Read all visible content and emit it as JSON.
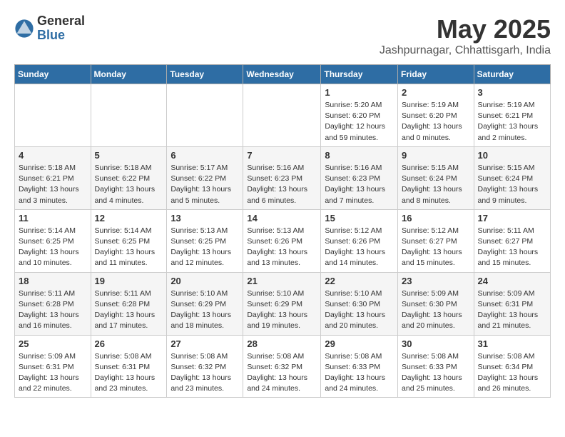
{
  "logo": {
    "general": "General",
    "blue": "Blue"
  },
  "title": "May 2025",
  "subtitle": "Jashpurnagar, Chhattisgarh, India",
  "days_of_week": [
    "Sunday",
    "Monday",
    "Tuesday",
    "Wednesday",
    "Thursday",
    "Friday",
    "Saturday"
  ],
  "weeks": [
    [
      {
        "day": "",
        "info": ""
      },
      {
        "day": "",
        "info": ""
      },
      {
        "day": "",
        "info": ""
      },
      {
        "day": "",
        "info": ""
      },
      {
        "day": "1",
        "info": "Sunrise: 5:20 AM\nSunset: 6:20 PM\nDaylight: 12 hours\nand 59 minutes."
      },
      {
        "day": "2",
        "info": "Sunrise: 5:19 AM\nSunset: 6:20 PM\nDaylight: 13 hours\nand 0 minutes."
      },
      {
        "day": "3",
        "info": "Sunrise: 5:19 AM\nSunset: 6:21 PM\nDaylight: 13 hours\nand 2 minutes."
      }
    ],
    [
      {
        "day": "4",
        "info": "Sunrise: 5:18 AM\nSunset: 6:21 PM\nDaylight: 13 hours\nand 3 minutes."
      },
      {
        "day": "5",
        "info": "Sunrise: 5:18 AM\nSunset: 6:22 PM\nDaylight: 13 hours\nand 4 minutes."
      },
      {
        "day": "6",
        "info": "Sunrise: 5:17 AM\nSunset: 6:22 PM\nDaylight: 13 hours\nand 5 minutes."
      },
      {
        "day": "7",
        "info": "Sunrise: 5:16 AM\nSunset: 6:23 PM\nDaylight: 13 hours\nand 6 minutes."
      },
      {
        "day": "8",
        "info": "Sunrise: 5:16 AM\nSunset: 6:23 PM\nDaylight: 13 hours\nand 7 minutes."
      },
      {
        "day": "9",
        "info": "Sunrise: 5:15 AM\nSunset: 6:24 PM\nDaylight: 13 hours\nand 8 minutes."
      },
      {
        "day": "10",
        "info": "Sunrise: 5:15 AM\nSunset: 6:24 PM\nDaylight: 13 hours\nand 9 minutes."
      }
    ],
    [
      {
        "day": "11",
        "info": "Sunrise: 5:14 AM\nSunset: 6:25 PM\nDaylight: 13 hours\nand 10 minutes."
      },
      {
        "day": "12",
        "info": "Sunrise: 5:14 AM\nSunset: 6:25 PM\nDaylight: 13 hours\nand 11 minutes."
      },
      {
        "day": "13",
        "info": "Sunrise: 5:13 AM\nSunset: 6:25 PM\nDaylight: 13 hours\nand 12 minutes."
      },
      {
        "day": "14",
        "info": "Sunrise: 5:13 AM\nSunset: 6:26 PM\nDaylight: 13 hours\nand 13 minutes."
      },
      {
        "day": "15",
        "info": "Sunrise: 5:12 AM\nSunset: 6:26 PM\nDaylight: 13 hours\nand 14 minutes."
      },
      {
        "day": "16",
        "info": "Sunrise: 5:12 AM\nSunset: 6:27 PM\nDaylight: 13 hours\nand 15 minutes."
      },
      {
        "day": "17",
        "info": "Sunrise: 5:11 AM\nSunset: 6:27 PM\nDaylight: 13 hours\nand 15 minutes."
      }
    ],
    [
      {
        "day": "18",
        "info": "Sunrise: 5:11 AM\nSunset: 6:28 PM\nDaylight: 13 hours\nand 16 minutes."
      },
      {
        "day": "19",
        "info": "Sunrise: 5:11 AM\nSunset: 6:28 PM\nDaylight: 13 hours\nand 17 minutes."
      },
      {
        "day": "20",
        "info": "Sunrise: 5:10 AM\nSunset: 6:29 PM\nDaylight: 13 hours\nand 18 minutes."
      },
      {
        "day": "21",
        "info": "Sunrise: 5:10 AM\nSunset: 6:29 PM\nDaylight: 13 hours\nand 19 minutes."
      },
      {
        "day": "22",
        "info": "Sunrise: 5:10 AM\nSunset: 6:30 PM\nDaylight: 13 hours\nand 20 minutes."
      },
      {
        "day": "23",
        "info": "Sunrise: 5:09 AM\nSunset: 6:30 PM\nDaylight: 13 hours\nand 20 minutes."
      },
      {
        "day": "24",
        "info": "Sunrise: 5:09 AM\nSunset: 6:31 PM\nDaylight: 13 hours\nand 21 minutes."
      }
    ],
    [
      {
        "day": "25",
        "info": "Sunrise: 5:09 AM\nSunset: 6:31 PM\nDaylight: 13 hours\nand 22 minutes."
      },
      {
        "day": "26",
        "info": "Sunrise: 5:08 AM\nSunset: 6:31 PM\nDaylight: 13 hours\nand 23 minutes."
      },
      {
        "day": "27",
        "info": "Sunrise: 5:08 AM\nSunset: 6:32 PM\nDaylight: 13 hours\nand 23 minutes."
      },
      {
        "day": "28",
        "info": "Sunrise: 5:08 AM\nSunset: 6:32 PM\nDaylight: 13 hours\nand 24 minutes."
      },
      {
        "day": "29",
        "info": "Sunrise: 5:08 AM\nSunset: 6:33 PM\nDaylight: 13 hours\nand 24 minutes."
      },
      {
        "day": "30",
        "info": "Sunrise: 5:08 AM\nSunset: 6:33 PM\nDaylight: 13 hours\nand 25 minutes."
      },
      {
        "day": "31",
        "info": "Sunrise: 5:08 AM\nSunset: 6:34 PM\nDaylight: 13 hours\nand 26 minutes."
      }
    ]
  ]
}
